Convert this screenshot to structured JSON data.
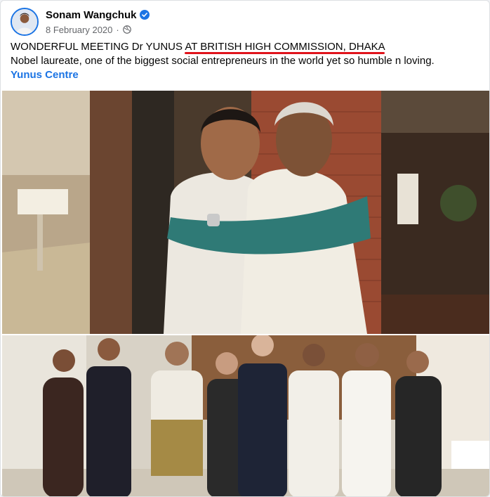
{
  "post": {
    "author": "Sonam Wangchuk",
    "verified_icon": "verified-badge-icon",
    "date": "8 February 2020",
    "separator": "·",
    "audience_icon": "globe-icon",
    "text_line1": "WONDERFUL MEETING Dr YUNUS AT BRITISH HIGH COMMISSION, DHAKA",
    "text_line2": "Nobel laureate, one of the biggest social entrepreneurs in the world yet so humble n loving.",
    "link": "Yunus Centre",
    "highlight_color": "#e0141c",
    "link_color": "#1b74e4"
  }
}
